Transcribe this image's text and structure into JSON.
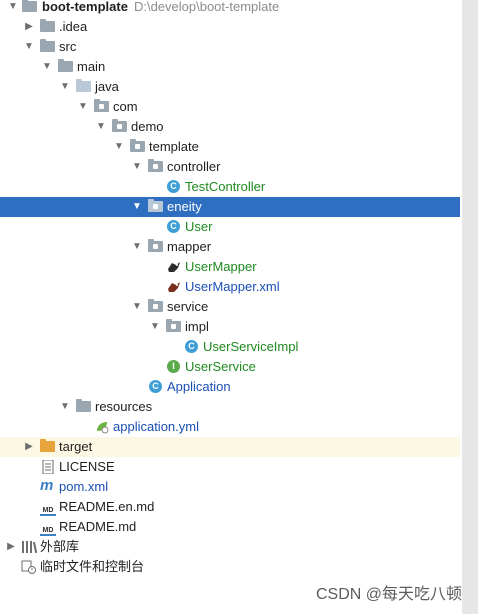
{
  "tree": {
    "root": {
      "name": "boot-template",
      "path": "D:\\develop\\boot-template"
    },
    "idea": ".idea",
    "src": "src",
    "main": "main",
    "java": "java",
    "com": "com",
    "demo": "demo",
    "template": "template",
    "controller": "controller",
    "test_controller": "TestController",
    "eneity": "eneity",
    "user": "User",
    "mapper": "mapper",
    "user_mapper": "UserMapper",
    "user_mapper_xml": "UserMapper.xml",
    "service": "service",
    "impl": "impl",
    "user_service_impl": "UserServiceImpl",
    "user_service": "UserService",
    "application": "Application",
    "resources": "resources",
    "application_yml": "application.yml",
    "target": "target",
    "license": "LICENSE",
    "pom": "pom.xml",
    "readme_en": "README.en.md",
    "readme": "README.md",
    "external_libs": "外部库",
    "scratches": "临时文件和控制台"
  },
  "icons": {
    "class_letter": "C",
    "interface_letter": "I",
    "maven_letter": "m",
    "md_badge": "MD"
  },
  "watermark": "CSDN @每天吃八顿",
  "colors": {
    "selection": "#2e6fc2",
    "folder": "#9aa7b0",
    "excluded": "#e8a33d"
  }
}
